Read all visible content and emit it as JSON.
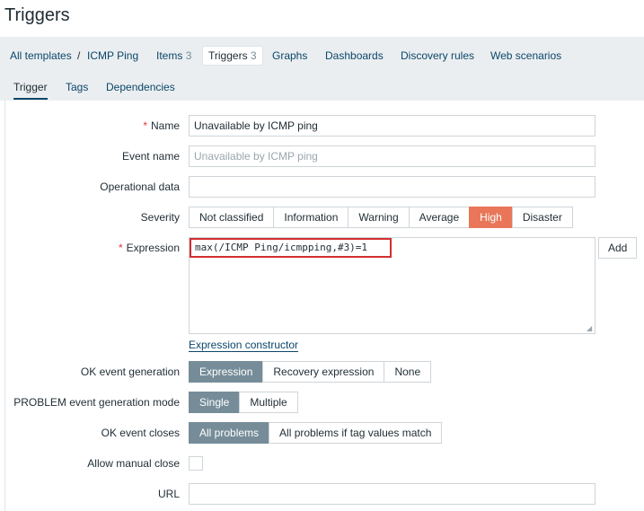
{
  "page": {
    "title": "Triggers"
  },
  "nav": {
    "all_templates": "All templates",
    "separator": "/",
    "template": "ICMP Ping",
    "items": {
      "label": "Items",
      "count": "3"
    },
    "triggers": {
      "label": "Triggers",
      "count": "3"
    },
    "graphs": "Graphs",
    "dashboards": "Dashboards",
    "discovery": "Discovery rules",
    "web": "Web scenarios"
  },
  "tabs": [
    "Trigger",
    "Tags",
    "Dependencies"
  ],
  "form": {
    "name": {
      "label": "Name",
      "value": "Unavailable by ICMP ping"
    },
    "event_name": {
      "label": "Event name",
      "placeholder": "Unavailable by ICMP ping"
    },
    "operational_data": {
      "label": "Operational data",
      "value": ""
    },
    "severity": {
      "label": "Severity",
      "options": [
        "Not classified",
        "Information",
        "Warning",
        "Average",
        "High",
        "Disaster"
      ],
      "selected": "High"
    },
    "expression": {
      "label": "Expression",
      "value": "max(/ICMP Ping/icmpping,#3)=1",
      "add_label": "Add",
      "constructor_link": "Expression constructor"
    },
    "ok_event_generation": {
      "label": "OK event generation",
      "options": [
        "Expression",
        "Recovery expression",
        "None"
      ],
      "selected": "Expression"
    },
    "problem_mode": {
      "label": "PROBLEM event generation mode",
      "options": [
        "Single",
        "Multiple"
      ],
      "selected": "Single"
    },
    "ok_event_closes": {
      "label": "OK event closes",
      "options": [
        "All problems",
        "All problems if tag values match"
      ],
      "selected": "All problems"
    },
    "allow_manual_close": {
      "label": "Allow manual close",
      "checked": false
    },
    "url": {
      "label": "URL",
      "value": ""
    }
  },
  "colors": {
    "accent": "#0a466a",
    "selected": "#768d99",
    "high": "#e97659",
    "required": "#e33734",
    "highlight": "#d32f2f"
  }
}
